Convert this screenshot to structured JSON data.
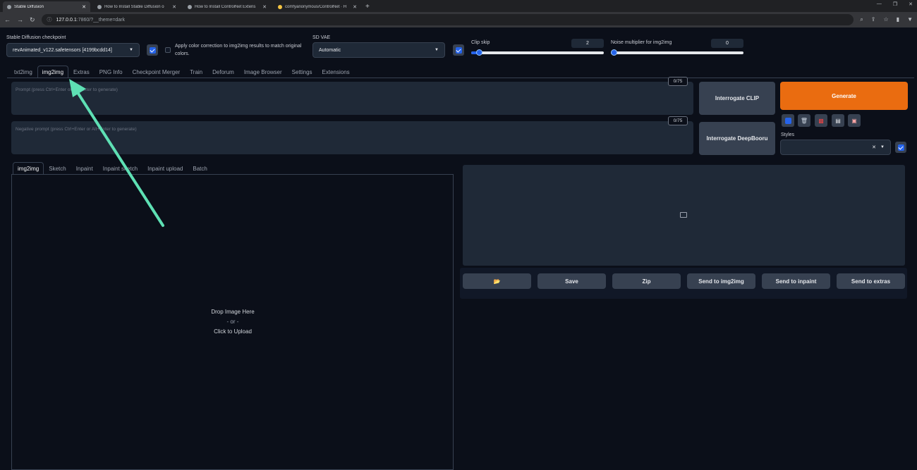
{
  "browser": {
    "tabs": [
      {
        "label": "Stable Diffusion"
      },
      {
        "label": "How to Install Stable Diffusion o"
      },
      {
        "label": "How to Install ControlNet Extens"
      },
      {
        "label": "comfyanonymous/ControlNet · H"
      }
    ],
    "url_host": "127.0.0.1",
    "url_rest": ":7860/?__theme=dark"
  },
  "top": {
    "checkpoint_label": "Stable Diffusion checkpoint",
    "checkpoint_value": "revAnimated_v122.safetensors [4199bcdd14]",
    "color_correction_label": "Apply color correction to img2img results to match original colors.",
    "vae_label": "SD VAE",
    "vae_value": "Automatic",
    "clip_skip_label": "Clip skip",
    "clip_skip_value": "2",
    "clip_skip_fraction": 0.06,
    "noise_label": "Noise multiplier for img2img",
    "noise_value": "0",
    "noise_fraction": 0.0
  },
  "main_tabs": [
    "txt2img",
    "img2img",
    "Extras",
    "PNG Info",
    "Checkpoint Merger",
    "Train",
    "Deforum",
    "Image Browser",
    "Settings",
    "Extensions"
  ],
  "prompt": {
    "placeholder": "Prompt (press Ctrl+Enter or Alt+Enter to generate)",
    "counter": "0/75"
  },
  "negative_prompt": {
    "placeholder": "Negative prompt (press Ctrl+Enter or Alt+Enter to generate)",
    "counter": "0/75"
  },
  "buttons": {
    "interrogate_clip": "Interrogate CLIP",
    "interrogate_deepbooru": "Interrogate DeepBooru",
    "generate": "Generate"
  },
  "styles_label": "Styles",
  "sub_tabs": [
    "img2img",
    "Sketch",
    "Inpaint",
    "Inpaint sketch",
    "Inpaint upload",
    "Batch"
  ],
  "drop": {
    "line1": "Drop Image Here",
    "line2": "- or -",
    "line3": "Click to Upload"
  },
  "output_buttons": {
    "folder_icon": "📂",
    "save": "Save",
    "zip": "Zip",
    "send_img2img": "Send to img2img",
    "send_inpaint": "Send to inpaint",
    "send_extras": "Send to extras"
  },
  "colors": {
    "background": "#0b0f19",
    "generate": "#ea6c10",
    "accent": "#2563eb",
    "annotation_arrow": "#5ee0b4"
  }
}
